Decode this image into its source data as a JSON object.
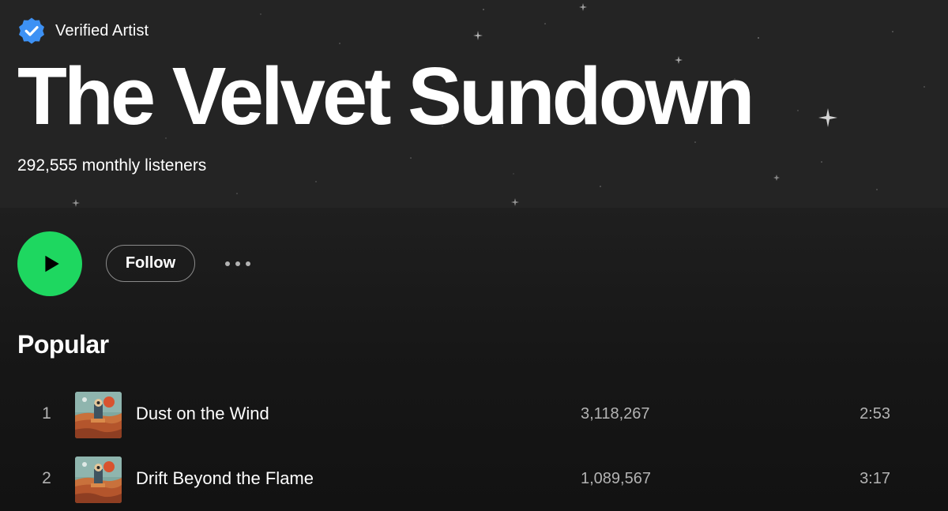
{
  "artist": {
    "verified_label": "Verified Artist",
    "name": "The Velvet Sundown",
    "monthly_listeners": "292,555 monthly listeners"
  },
  "actions": {
    "play_icon": "play-icon",
    "follow_label": "Follow",
    "more_icon": "more-options-icon"
  },
  "popular": {
    "title": "Popular",
    "tracks": [
      {
        "number": "1",
        "title": "Dust on the Wind",
        "plays": "3,118,267",
        "duration": "2:53"
      },
      {
        "number": "2",
        "title": "Drift Beyond the Flame",
        "plays": "1,089,567",
        "duration": "3:17"
      }
    ]
  },
  "colors": {
    "accent": "#1ed760",
    "verified": "#3d91f4",
    "header_bg": "#242424",
    "page_bg": "#121212",
    "secondary_text": "#b3b3b3"
  }
}
